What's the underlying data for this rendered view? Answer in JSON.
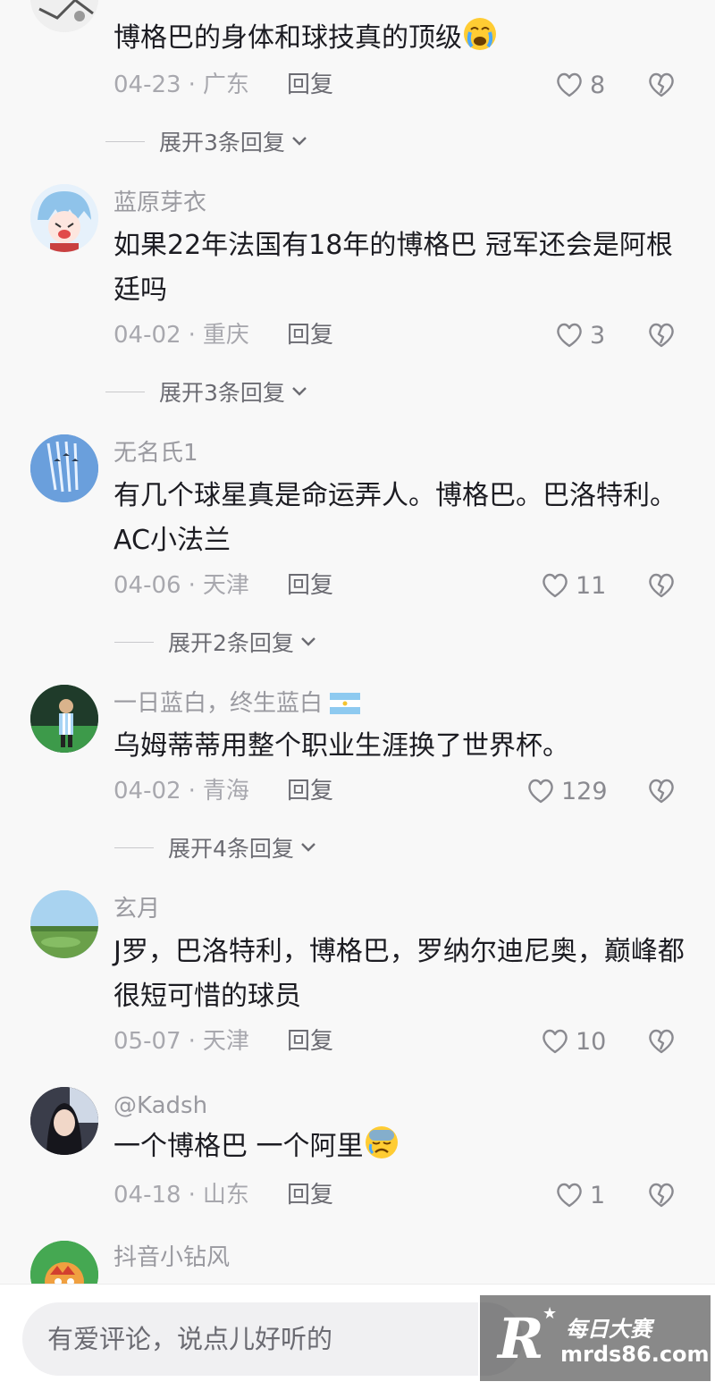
{
  "comments": [
    {
      "username": "",
      "text": "博格巴的身体和球技真的顶级",
      "emoji": "crying-face",
      "date": "04-23",
      "location": "广东",
      "reply_label": "回复",
      "likes": "8",
      "expand_label": "展开3条回复"
    },
    {
      "username": "蓝原芽衣",
      "text": "如果22年法国有18年的博格巴 冠军还会是阿根廷吗",
      "date": "04-02",
      "location": "重庆",
      "reply_label": "回复",
      "likes": "3",
      "expand_label": "展开3条回复"
    },
    {
      "username": "无名氏1",
      "text": "有几个球星真是命运弄人。博格巴。巴洛特利。AC小法兰",
      "date": "04-06",
      "location": "天津",
      "reply_label": "回复",
      "likes": "11",
      "expand_label": "展开2条回复"
    },
    {
      "username": "一日蓝白，终生蓝白",
      "text": "乌姆蒂蒂用整个职业生涯换了世界杯。",
      "date": "04-02",
      "location": "青海",
      "reply_label": "回复",
      "likes": "129",
      "expand_label": "展开4条回复"
    },
    {
      "username": "玄月",
      "text": "J罗，巴洛特利，博格巴，罗纳尔迪尼奥，巅峰都很短可惜的球员",
      "date": "05-07",
      "location": "天津",
      "reply_label": "回复",
      "likes": "10"
    },
    {
      "username": "@Kadsh",
      "text": "一个博格巴 一个阿里",
      "emoji": "sad-face",
      "date": "04-18",
      "location": "山东",
      "reply_label": "回复",
      "likes": "1"
    },
    {
      "username": "抖音小钻风"
    }
  ],
  "footer": {
    "input_placeholder": "有爱评论，说点儿好听的"
  },
  "watermark": {
    "letter": "R",
    "title": "每日大赛",
    "site": "mrds86.com"
  }
}
